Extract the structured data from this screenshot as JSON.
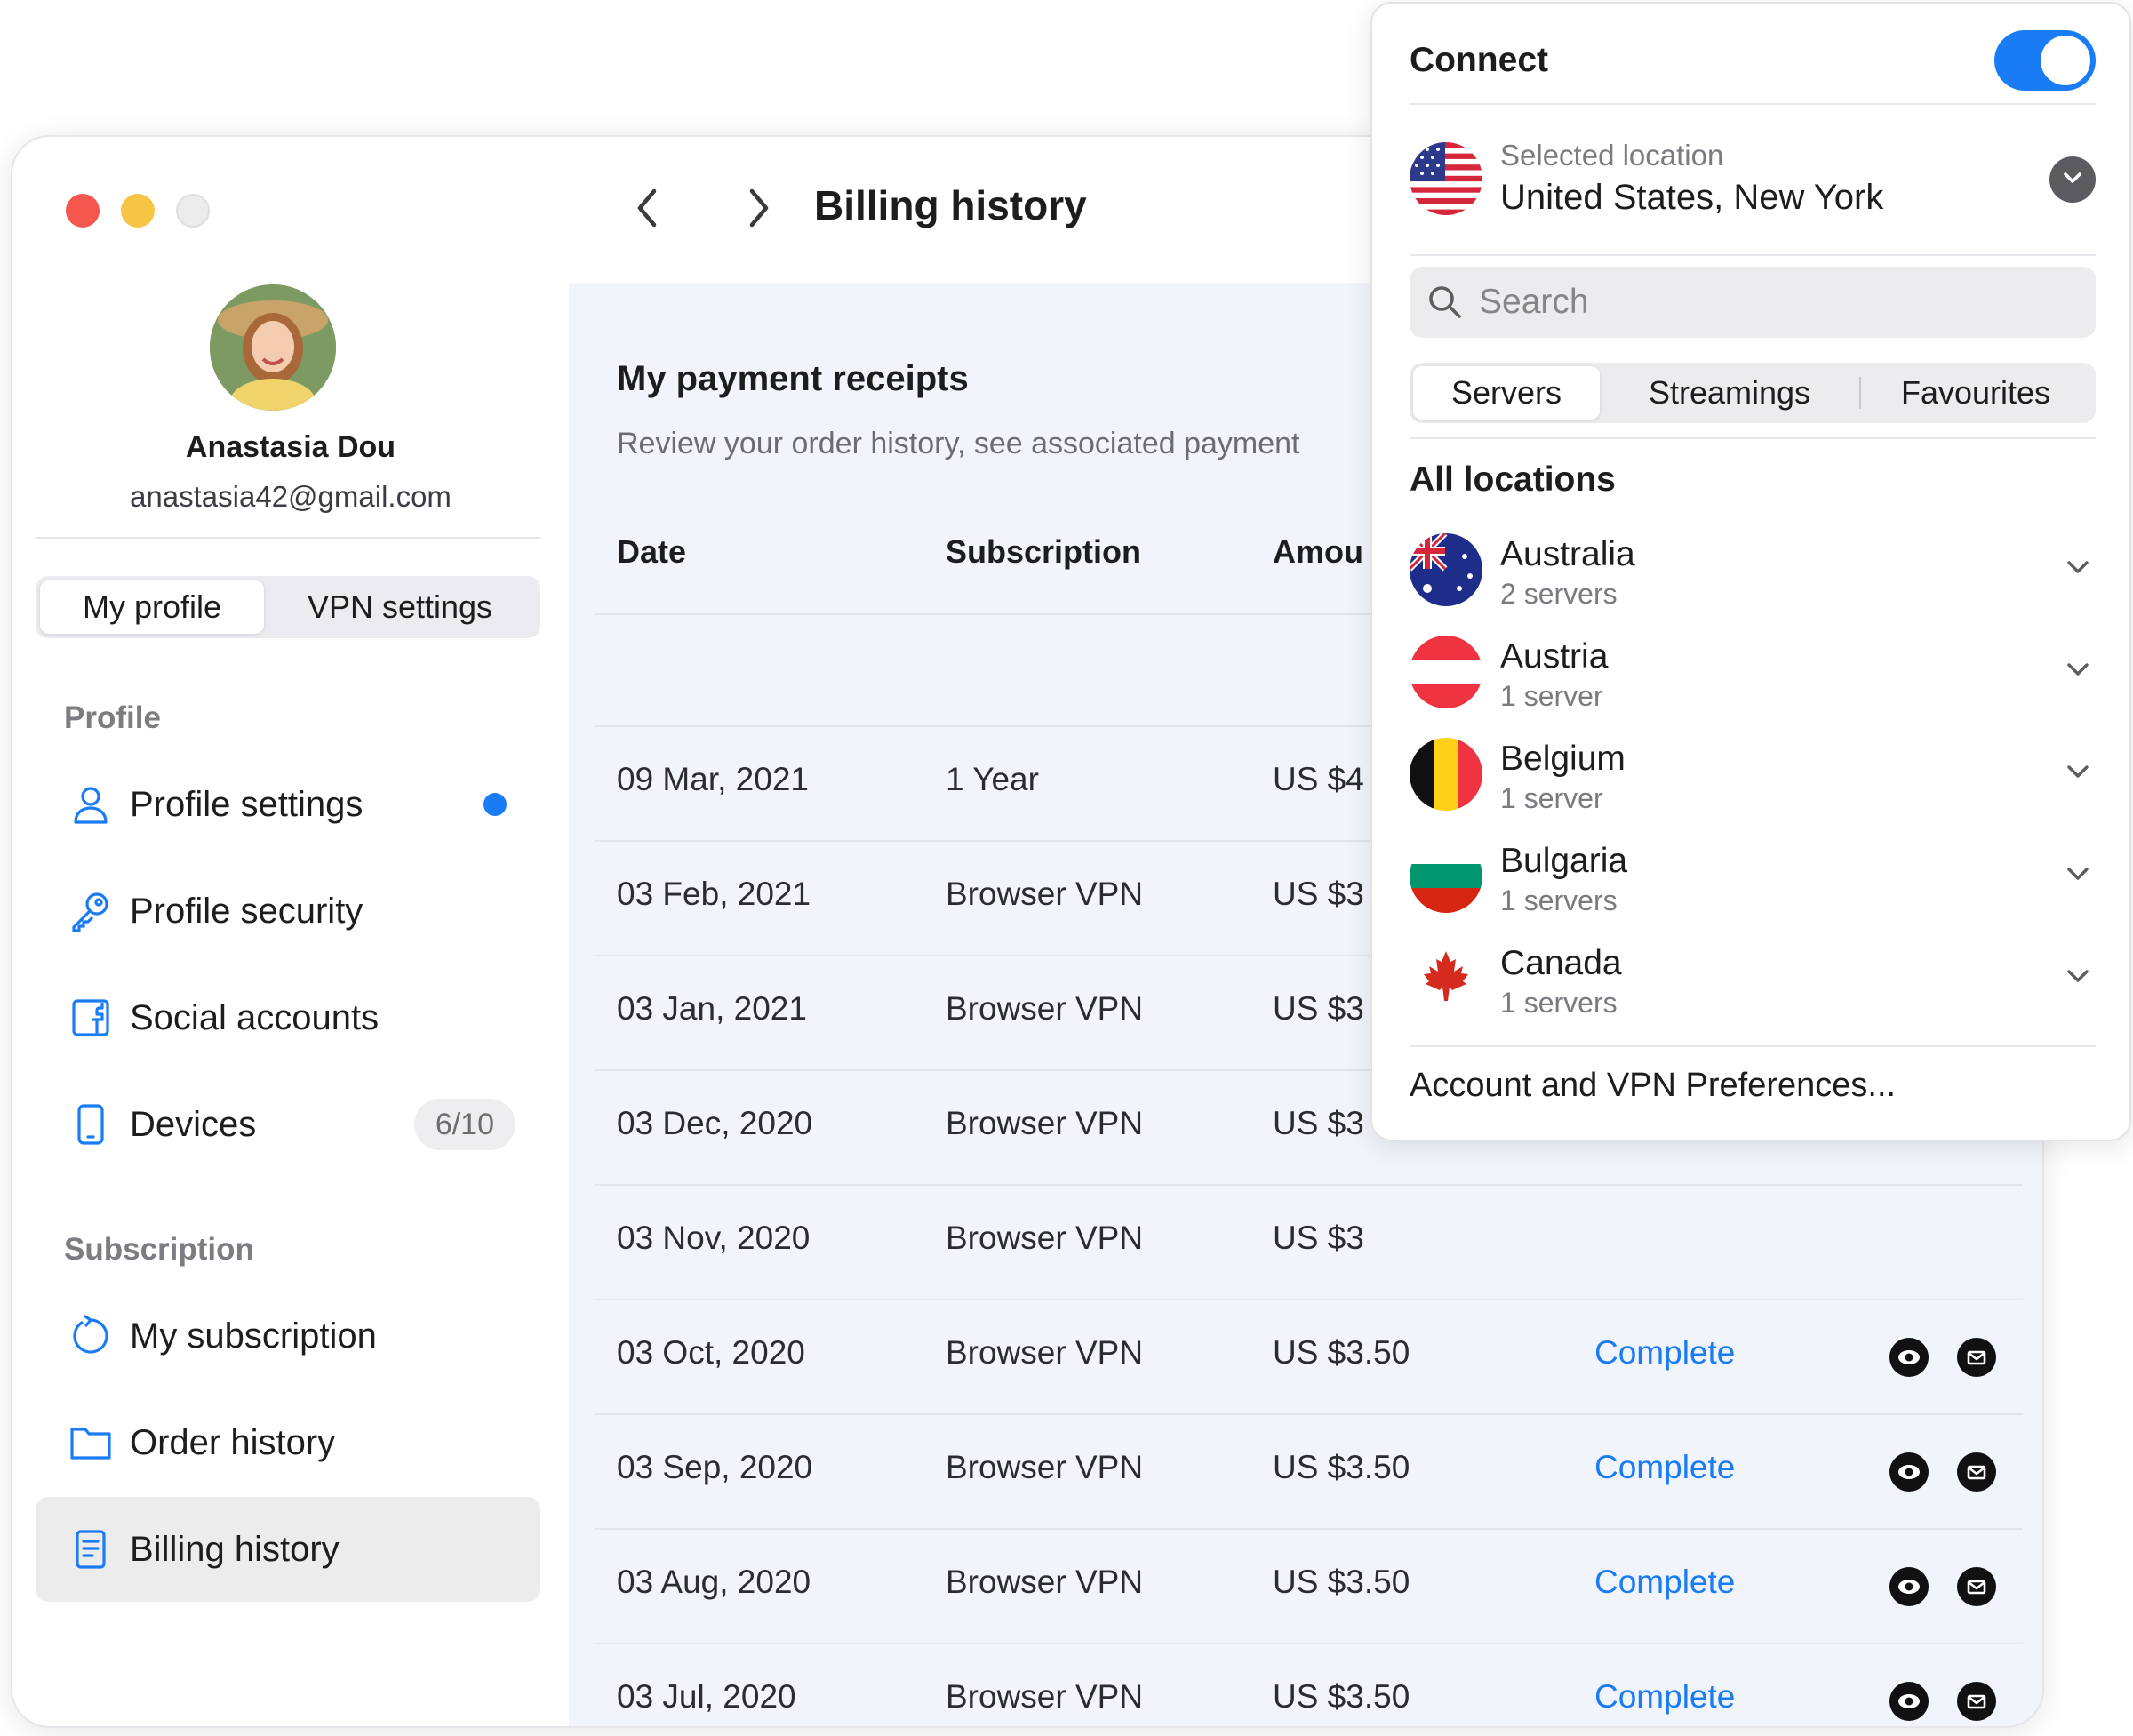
{
  "sidebar": {
    "user_name": "Anastasia Dou",
    "user_email": "anastasia42@gmail.com",
    "tabs": [
      "My profile",
      "VPN settings"
    ],
    "section_profile": "Profile",
    "section_subscription": "Subscription",
    "items": [
      {
        "label": "Profile settings",
        "icon": "user-icon"
      },
      {
        "label": "Profile security",
        "icon": "key-icon"
      },
      {
        "label": "Social accounts",
        "icon": "facebook-icon"
      },
      {
        "label": "Devices",
        "icon": "phone-icon",
        "badge": "6/10"
      },
      {
        "label": "My subscription",
        "icon": "refresh-icon"
      },
      {
        "label": "Order history",
        "icon": "folder-icon"
      },
      {
        "label": "Billing history",
        "icon": "document-icon"
      }
    ]
  },
  "header": {
    "title": "Billing history"
  },
  "content": {
    "title": "My payment receipts",
    "subtitle": "Review your order history, see associated payment",
    "columns": [
      "Date",
      "Subscription",
      "Amou"
    ],
    "rows": [
      {
        "date": "09 Mar, 2021",
        "subscription": "1 Year",
        "amount": "US $4",
        "status": ""
      },
      {
        "date": "03 Feb, 2021",
        "subscription": "Browser VPN",
        "amount": "US $3",
        "status": ""
      },
      {
        "date": "03 Jan, 2021",
        "subscription": "Browser VPN",
        "amount": "US $3",
        "status": ""
      },
      {
        "date": "03 Dec, 2020",
        "subscription": "Browser VPN",
        "amount": "US $3",
        "status": ""
      },
      {
        "date": "03 Nov, 2020",
        "subscription": "Browser VPN",
        "amount": "US $3",
        "status": ""
      },
      {
        "date": "03 Oct, 2020",
        "subscription": "Browser VPN",
        "amount": "US $3.50",
        "status": "Complete"
      },
      {
        "date": "03 Sep, 2020",
        "subscription": "Browser VPN",
        "amount": "US $3.50",
        "status": "Complete"
      },
      {
        "date": "03 Aug, 2020",
        "subscription": "Browser VPN",
        "amount": "US $3.50",
        "status": "Complete"
      },
      {
        "date": "03 Jul, 2020",
        "subscription": "Browser VPN",
        "amount": "US $3.50",
        "status": "Complete"
      }
    ]
  },
  "vpn": {
    "connect_label": "Connect",
    "connected": true,
    "selected_label": "Selected location",
    "selected_value": "United States, New York",
    "search_placeholder": "Search",
    "tabs": [
      "Servers",
      "Streamings",
      "Favourites"
    ],
    "all_locations": "All locations",
    "locations": [
      {
        "name": "Australia",
        "count": "2 servers"
      },
      {
        "name": "Austria",
        "count": "1 server"
      },
      {
        "name": "Belgium",
        "count": "1 server"
      },
      {
        "name": "Bulgaria",
        "count": "1 servers"
      },
      {
        "name": "Canada",
        "count": "1 servers"
      }
    ],
    "preferences": "Account and VPN Preferences..."
  },
  "colors": {
    "accent": "#1a7cf5",
    "content_bg": "#f1f5fb",
    "active_item_bg": "#ececec"
  }
}
